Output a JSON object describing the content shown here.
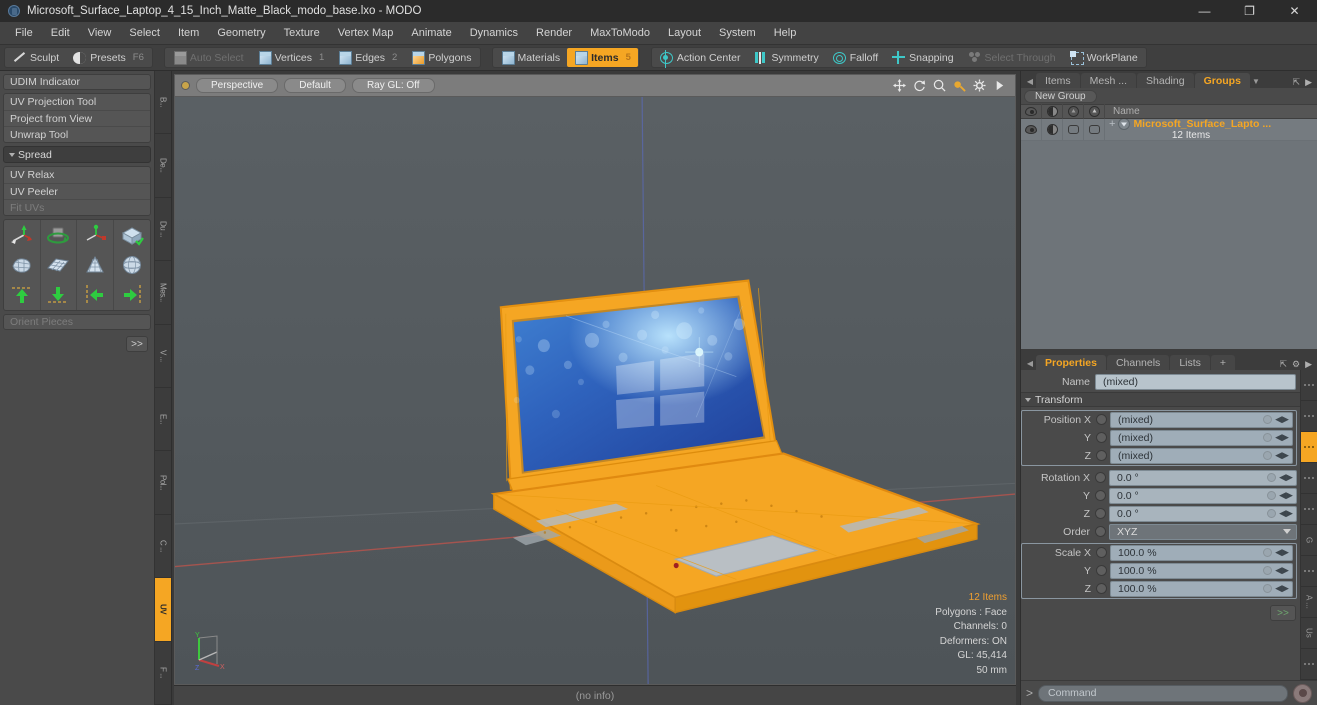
{
  "titlebar": {
    "title": "Microsoft_Surface_Laptop_4_15_Inch_Matte_Black_modo_base.lxo - MODO",
    "app_icon": "modo-app-icon",
    "minimize": "—",
    "maximize": "❐",
    "close": "✕"
  },
  "menubar": {
    "items": [
      {
        "label": "File"
      },
      {
        "label": "Edit"
      },
      {
        "label": "View"
      },
      {
        "label": "Select"
      },
      {
        "label": "Item"
      },
      {
        "label": "Geometry"
      },
      {
        "label": "Texture"
      },
      {
        "label": "Vertex Map"
      },
      {
        "label": "Animate"
      },
      {
        "label": "Dynamics"
      },
      {
        "label": "Render"
      },
      {
        "label": "MaxToModo"
      },
      {
        "label": "Layout"
      },
      {
        "label": "System"
      },
      {
        "label": "Help"
      }
    ]
  },
  "toolbar": {
    "group1": [
      {
        "label": "Sculpt",
        "icon": "pencil-icon",
        "shortcut": "",
        "state": "normal"
      },
      {
        "label": "Presets",
        "icon": "moon-icon",
        "shortcut": "F6",
        "state": "normal"
      }
    ],
    "group2": [
      {
        "label": "Auto Select",
        "icon": "cube-icon",
        "shortcut": "",
        "state": "disabled"
      },
      {
        "label": "Vertices",
        "icon": "cube-icon",
        "shortcut": "1",
        "state": "normal"
      },
      {
        "label": "Edges",
        "icon": "cube-icon",
        "shortcut": "2",
        "state": "normal"
      },
      {
        "label": "Polygons",
        "icon": "cube-icon",
        "shortcut": "",
        "state": "normal"
      }
    ],
    "group3": [
      {
        "label": "Materials",
        "icon": "cube-icon",
        "shortcut": "",
        "state": "normal"
      },
      {
        "label": "Items",
        "icon": "cube-icon",
        "shortcut": "5",
        "state": "active"
      }
    ],
    "group4": [
      {
        "label": "Action Center",
        "icon": "action-center-icon",
        "state": "normal"
      },
      {
        "label": "Symmetry",
        "icon": "symmetry-icon",
        "state": "normal"
      },
      {
        "label": "Falloff",
        "icon": "falloff-icon",
        "state": "normal"
      },
      {
        "label": "Snapping",
        "icon": "snapping-icon",
        "state": "normal"
      },
      {
        "label": "Select Through",
        "icon": "select-through-icon",
        "state": "disabled"
      },
      {
        "label": "WorkPlane",
        "icon": "workplane-icon",
        "state": "normal"
      }
    ]
  },
  "left_panel": {
    "udim": "UDIM Indicator",
    "uv_group": [
      "UV Projection Tool",
      "Project from View",
      "Unwrap Tool"
    ],
    "spread_header": "Spread",
    "relax_group": [
      "UV Relax",
      "UV Peeler"
    ],
    "fit_uvs": "Fit UVs",
    "icon_rows": [
      [
        "uv-move-icon",
        "uv-rotate-icon",
        "uv-transform-icon",
        "uv-fit-icon"
      ],
      [
        "uv-mesh-icon",
        "uv-grid-icon",
        "uv-cone-icon",
        "uv-sphere-icon"
      ],
      [
        "align-up-icon",
        "align-down-icon",
        "align-left-icon",
        "align-right-icon"
      ]
    ],
    "orient_pieces": "Orient Pieces",
    "more_button": ">>",
    "vtabs": [
      {
        "label": "B...",
        "active": false
      },
      {
        "label": "De...",
        "active": false
      },
      {
        "label": "Du ...",
        "active": false
      },
      {
        "label": "Mes...",
        "active": false
      },
      {
        "label": "V ...",
        "active": false
      },
      {
        "label": "E...",
        "active": false
      },
      {
        "label": "Pol...",
        "active": false
      },
      {
        "label": "C ...",
        "active": false
      },
      {
        "label": "UV",
        "active": true
      },
      {
        "label": "F ...",
        "active": false
      }
    ]
  },
  "viewport": {
    "header_buttons": [
      "Perspective",
      "Default",
      "Ray GL: Off"
    ],
    "header_icons": [
      "pan-icon",
      "rotate-icon",
      "zoom-icon",
      "light-icon",
      "gear-icon",
      "chevron-right-icon"
    ],
    "stats": [
      {
        "text": "12 Items",
        "highlight": true
      },
      {
        "text": "Polygons : Face",
        "highlight": false
      },
      {
        "text": "Channels: 0",
        "highlight": false
      },
      {
        "text": "Deformers: ON",
        "highlight": false
      },
      {
        "text": "GL: 45,414",
        "highlight": false
      },
      {
        "text": "50 mm",
        "highlight": false
      }
    ],
    "gizmo_labels": {
      "x": "X",
      "y": "Y",
      "z": "Z"
    },
    "footer_info": "(no info)",
    "colors": {
      "background": "#555a5e",
      "selection": "#f5a623",
      "screen_blue": "#2a52a8",
      "axis_x": "#cc5555",
      "axis_z": "#5566cc"
    }
  },
  "right_panel": {
    "top_tabs": [
      {
        "label": "Items",
        "active": false
      },
      {
        "label": "Mesh ...",
        "active": false
      },
      {
        "label": "Shading",
        "active": false
      },
      {
        "label": "Groups",
        "active": true
      }
    ],
    "new_group_button": "New Group",
    "list_columns": [
      "eye-icon",
      "shade-icon",
      "lock-icon",
      "render-icon",
      "Name"
    ],
    "list_name_header": "Name",
    "list_rows": [
      {
        "name": "Microsoft_Surface_Lapto ...",
        "sub": "12 Items",
        "expander": "+"
      }
    ],
    "prop_tabs": [
      {
        "label": "Properties",
        "active": true
      },
      {
        "label": "Channels",
        "active": false
      },
      {
        "label": "Lists",
        "active": false
      },
      {
        "label": "+",
        "active": false
      }
    ],
    "name_label": "Name",
    "name_value": "(mixed)",
    "transform_header": "Transform",
    "fields": [
      {
        "label": "Position X",
        "value": "(mixed)",
        "type": "text",
        "grouped": true
      },
      {
        "label": "Y",
        "value": "(mixed)",
        "type": "text",
        "grouped": true
      },
      {
        "label": "Z",
        "value": "(mixed)",
        "type": "text",
        "grouped": true
      },
      {
        "label": "Rotation X",
        "value": "0.0 °",
        "type": "text",
        "grouped": false
      },
      {
        "label": "Y",
        "value": "0.0 °",
        "type": "text",
        "grouped": false
      },
      {
        "label": "Z",
        "value": "0.0 °",
        "type": "text",
        "grouped": false
      },
      {
        "label": "Order",
        "value": "XYZ",
        "type": "dropdown",
        "grouped": false
      },
      {
        "label": "Scale X",
        "value": "100.0 %",
        "type": "text",
        "grouped": true
      },
      {
        "label": "Y",
        "value": "100.0 %",
        "type": "text",
        "grouped": true
      },
      {
        "label": "Z",
        "value": "100.0 %",
        "type": "text",
        "grouped": true
      }
    ],
    "more_button": ">>",
    "vtabs": [
      {
        "label": "",
        "active": false
      },
      {
        "label": "",
        "active": false
      },
      {
        "label": "",
        "active": true
      },
      {
        "label": "",
        "active": false
      },
      {
        "label": "",
        "active": false
      },
      {
        "label": "G",
        "active": false
      },
      {
        "label": "",
        "active": false
      },
      {
        "label": "A ...",
        "active": false
      },
      {
        "label": "Us",
        "active": false
      },
      {
        "label": "",
        "active": false
      }
    ],
    "command": {
      "prompt": ">",
      "placeholder": "Command",
      "button": "record-icon"
    }
  }
}
